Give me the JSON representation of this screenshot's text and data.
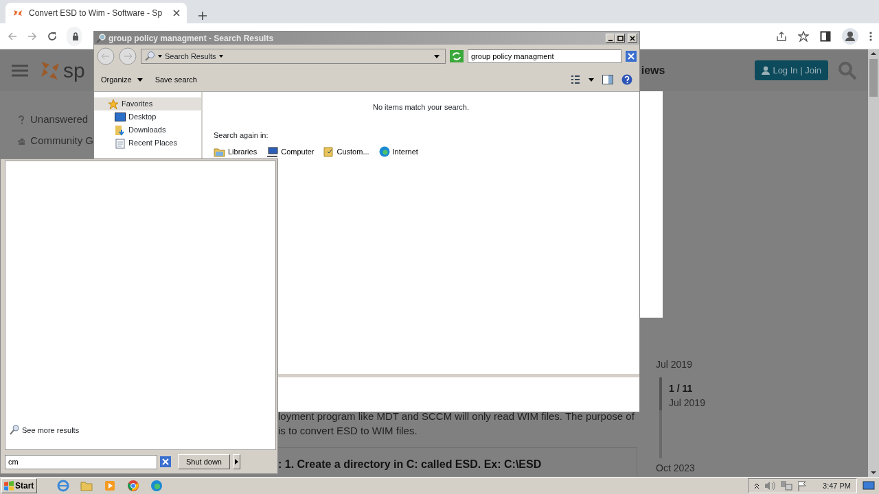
{
  "browser": {
    "tab_title": "Convert ESD to Wim - Software - Sp"
  },
  "web_page": {
    "logo_text": "sp",
    "nav_link": "iews",
    "login_button": "Log In | Join",
    "sidebar": [
      {
        "label": "Unanswered"
      },
      {
        "label": "Community G"
      }
    ],
    "body_lines": [
      "loyment program like MDT and SCCM will only read WIM files. The purpose of",
      "is to convert ESD to WIM files."
    ],
    "step_heading": ": 1. Create a directory in C: called ESD. Ex: C:\\ESD",
    "timeline": {
      "start": "Jul 2019",
      "position": "1 / 11",
      "date": "Jul 2019",
      "end": "Oct 2023"
    }
  },
  "explorer": {
    "title": "group policy managment - Search Results",
    "breadcrumb": "Search Results",
    "search_value": "group policy managment",
    "toolbar": [
      {
        "label": "Organize",
        "dropdown": true
      },
      {
        "label": "Save search",
        "dropdown": false
      }
    ],
    "nav": [
      {
        "label": "Favorites",
        "selected": true,
        "children": [
          {
            "label": "Desktop",
            "selected": false
          },
          {
            "label": "Downloads",
            "selected": false
          },
          {
            "label": "Recent Places",
            "selected": false
          }
        ]
      }
    ],
    "message": "No items match your search.",
    "search_again_label": "Search again in:",
    "locations": [
      {
        "label": "Libraries"
      },
      {
        "label": "Computer"
      },
      {
        "label": "Custom..."
      },
      {
        "label": "Internet"
      }
    ]
  },
  "start_menu": {
    "see_more": "See more results",
    "search_value": "cm",
    "shutdown": "Shut down"
  },
  "taskbar": {
    "start": "Start",
    "clock": "3:47 PM"
  }
}
